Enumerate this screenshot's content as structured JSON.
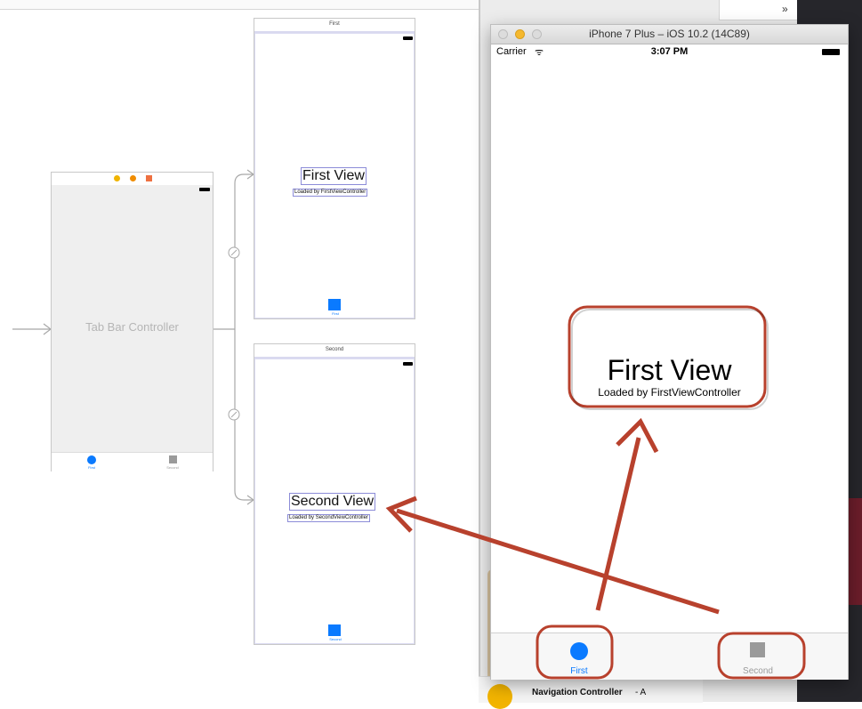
{
  "storyboard": {
    "tab_bar_controller": {
      "title": "Tab Bar Controller",
      "tab_first": "First",
      "tab_second": "Second"
    },
    "first_scene": {
      "header": "First",
      "label": "First View",
      "sublabel": "Loaded by FirstViewController",
      "tab_label": "First"
    },
    "second_scene": {
      "header": "Second",
      "label": "Second View",
      "sublabel": "Loaded by SecondViewController",
      "tab_label": "Second"
    }
  },
  "simulator": {
    "window_title": "iPhone 7 Plus – iOS 10.2 (14C89)",
    "carrier": "Carrier",
    "time": "3:07 PM",
    "label": "First View",
    "sublabel": "Loaded by FirstViewController",
    "tab_first": "First",
    "tab_second": "Second"
  },
  "right_panel": {
    "more_chevron": "»",
    "library_item_title": "Navigation Controller",
    "library_item_desc": " - A"
  },
  "colors": {
    "accent_blue": "#0a7aff",
    "annotation_red": "#b8412d",
    "tab_gray": "#9a9a9a"
  }
}
